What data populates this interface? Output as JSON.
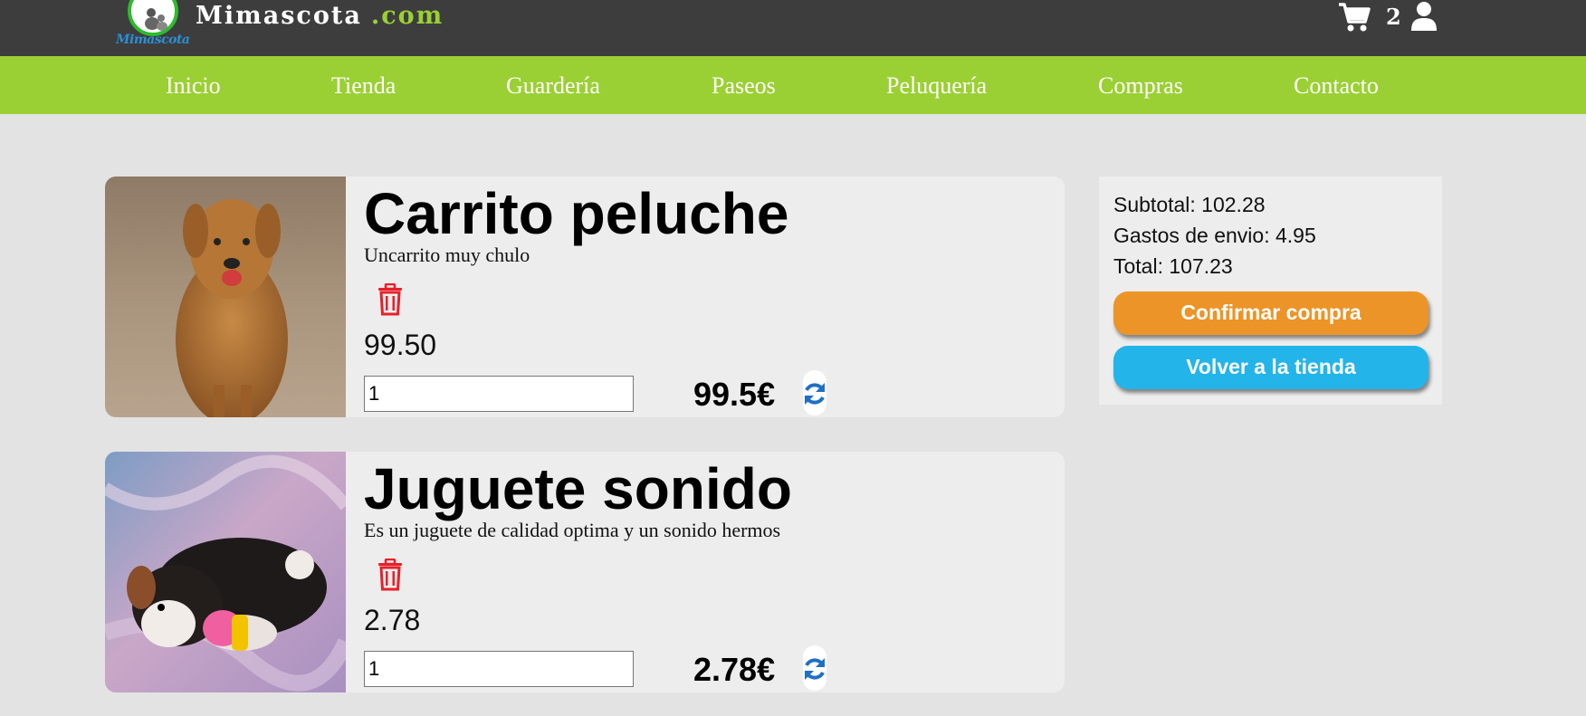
{
  "header": {
    "logo_text": "Mimascota",
    "brand_name": "Mimascota",
    "brand_domain": ".com",
    "cart_count": "2",
    "cart_icon": "cart-icon",
    "user_icon": "user-icon"
  },
  "nav": {
    "items": [
      {
        "label": "Inicio"
      },
      {
        "label": "Tienda"
      },
      {
        "label": "Guardería"
      },
      {
        "label": "Paseos"
      },
      {
        "label": "Peluquería"
      },
      {
        "label": "Compras"
      },
      {
        "label": "Contacto"
      }
    ]
  },
  "cart": {
    "items": [
      {
        "title": "Carrito peluche",
        "description": "Uncarrito muy chulo",
        "price": "99.50",
        "quantity": "1",
        "line_total": "99.5€"
      },
      {
        "title": "Juguete sonido",
        "description": "Es un juguete de calidad optima y un sonido hermos",
        "price": "2.78",
        "quantity": "1",
        "line_total": "2.78€"
      }
    ]
  },
  "summary": {
    "subtotal": "Subtotal: 102.28",
    "shipping": "Gastos de envio: 4.95",
    "total": "Total: 107.23",
    "confirm_label": "Confirmar compra",
    "back_label": "Volver a la tienda"
  },
  "colors": {
    "topbar": "#3d3d3d",
    "nav": "#9ad033",
    "confirm": "#ec9427",
    "back": "#23b4ea",
    "trash": "#e8202a",
    "refresh": "#1f6fc4"
  }
}
